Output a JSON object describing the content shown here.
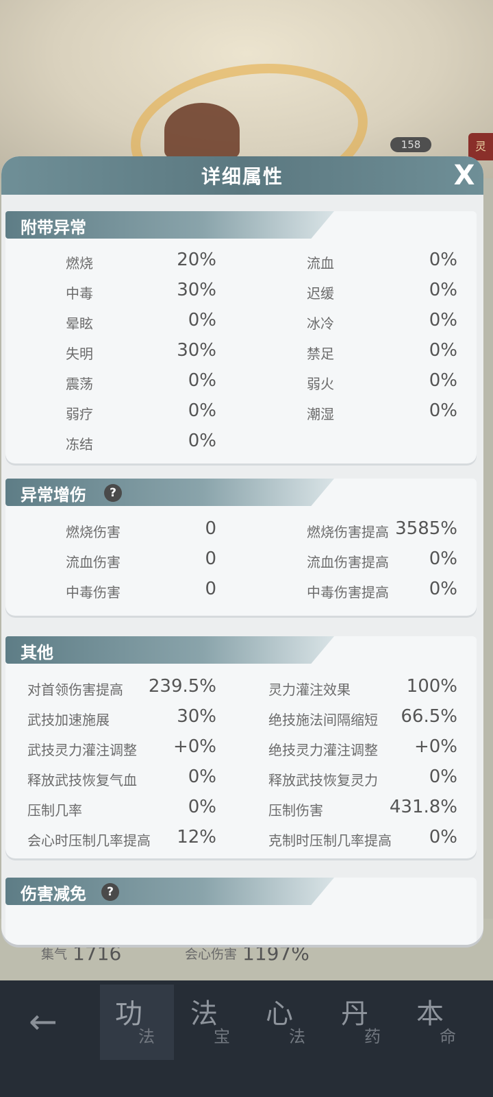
{
  "background": {
    "level_badge": "158",
    "side_tag": "灵",
    "stats": [
      {
        "label": "集气",
        "value": "1716"
      },
      {
        "label": "会心伤害",
        "value": "1197%"
      }
    ]
  },
  "nav": {
    "tabs": [
      {
        "big": "功",
        "small": "法"
      },
      {
        "big": "法",
        "small": "宝"
      },
      {
        "big": "心",
        "small": "法"
      },
      {
        "big": "丹",
        "small": "药"
      },
      {
        "big": "本",
        "small": "命"
      }
    ]
  },
  "dialog": {
    "title": "详细属性",
    "close_label": "X"
  },
  "sections": {
    "abnormal": {
      "title": "附带异常",
      "left": [
        {
          "label": "燃烧",
          "value": "20%"
        },
        {
          "label": "中毒",
          "value": "30%"
        },
        {
          "label": "晕眩",
          "value": "0%"
        },
        {
          "label": "失明",
          "value": "30%"
        },
        {
          "label": "震荡",
          "value": "0%"
        },
        {
          "label": "弱疗",
          "value": "0%"
        },
        {
          "label": "冻结",
          "value": "0%"
        }
      ],
      "right": [
        {
          "label": "流血",
          "value": "0%"
        },
        {
          "label": "迟缓",
          "value": "0%"
        },
        {
          "label": "冰冷",
          "value": "0%"
        },
        {
          "label": "禁足",
          "value": "0%"
        },
        {
          "label": "弱火",
          "value": "0%"
        },
        {
          "label": "潮湿",
          "value": "0%"
        }
      ]
    },
    "abnormal_dmg": {
      "title": "异常增伤",
      "help": "?",
      "left": [
        {
          "label": "燃烧伤害",
          "value": "0"
        },
        {
          "label": "流血伤害",
          "value": "0"
        },
        {
          "label": "中毒伤害",
          "value": "0"
        }
      ],
      "right": [
        {
          "label": "燃烧伤害提高",
          "value": "3585%"
        },
        {
          "label": "流血伤害提高",
          "value": "0%"
        },
        {
          "label": "中毒伤害提高",
          "value": "0%"
        }
      ]
    },
    "other": {
      "title": "其他",
      "left": [
        {
          "label": "对首领伤害提高",
          "value": "239.5%"
        },
        {
          "label": "武技加速施展",
          "value": "30%"
        },
        {
          "label": "武技灵力灌注调整",
          "value": "+0%"
        },
        {
          "label": "释放武技恢复气血",
          "value": "0%"
        },
        {
          "label": "压制几率",
          "value": "0%"
        },
        {
          "label": "会心时压制几率提高",
          "value": "12%"
        }
      ],
      "right": [
        {
          "label": "灵力灌注效果",
          "value": "100%"
        },
        {
          "label": "绝技施法间隔缩短",
          "value": "66.5%"
        },
        {
          "label": "绝技灵力灌注调整",
          "value": "+0%"
        },
        {
          "label": "释放武技恢复灵力",
          "value": "0%"
        },
        {
          "label": "压制伤害",
          "value": "431.8%"
        },
        {
          "label": "克制时压制几率提高",
          "value": "0%"
        }
      ]
    },
    "dmg_reduce": {
      "title": "伤害减免",
      "help": "?"
    }
  }
}
